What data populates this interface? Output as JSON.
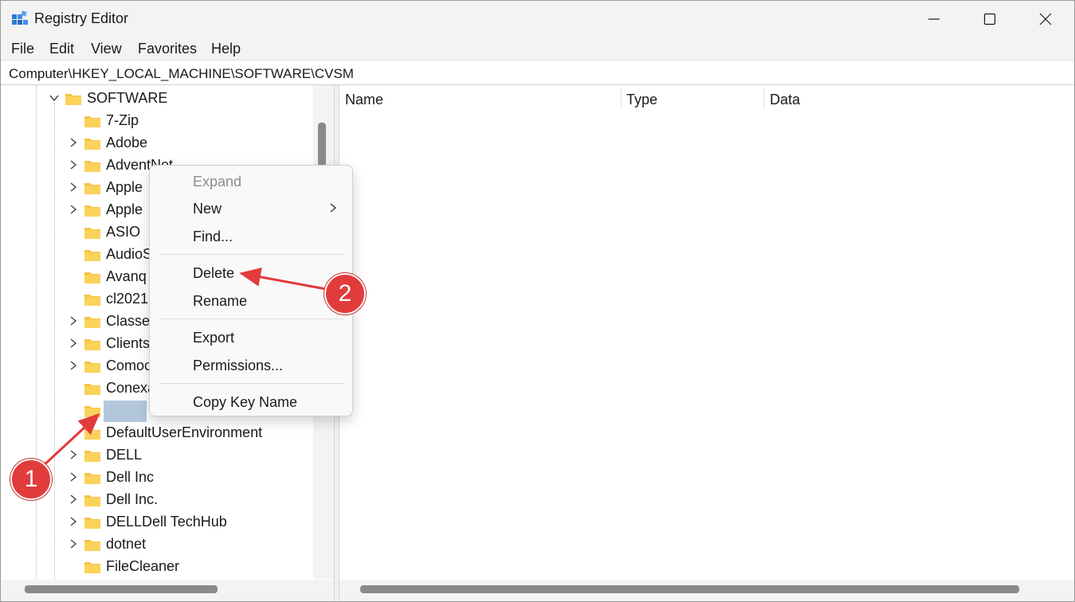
{
  "window": {
    "title": "Registry Editor"
  },
  "menu": {
    "items": [
      "File",
      "Edit",
      "View",
      "Favorites",
      "Help"
    ]
  },
  "address": {
    "path": "Computer\\HKEY_LOCAL_MACHINE\\SOFTWARE\\CVSM"
  },
  "tree": {
    "parent_label": "SOFTWARE",
    "nodes": [
      {
        "label": "7-Zip",
        "has_children": false
      },
      {
        "label": "Adobe",
        "has_children": true
      },
      {
        "label": "AdventNet",
        "has_children": true
      },
      {
        "label": "Apple",
        "has_children": true
      },
      {
        "label": "Apple",
        "has_children": true
      },
      {
        "label": "ASIO",
        "has_children": false
      },
      {
        "label": "AudioS",
        "has_children": false
      },
      {
        "label": "Avanq",
        "has_children": false
      },
      {
        "label": "cl2021",
        "has_children": false
      },
      {
        "label": "Classes",
        "has_children": true
      },
      {
        "label": "Clients",
        "has_children": true
      },
      {
        "label": "Comoc",
        "has_children": true
      },
      {
        "label": "Conexa",
        "has_children": false
      },
      {
        "label": "",
        "has_children": false,
        "selected": true
      },
      {
        "label": "DefaultUserEnvironment",
        "has_children": false
      },
      {
        "label": "DELL",
        "has_children": true
      },
      {
        "label": "Dell Inc",
        "has_children": true
      },
      {
        "label": "Dell Inc.",
        "has_children": true
      },
      {
        "label": "DELLDell TechHub",
        "has_children": true
      },
      {
        "label": "dotnet",
        "has_children": true
      },
      {
        "label": "FileCleaner",
        "has_children": false
      }
    ]
  },
  "list": {
    "columns": [
      "Name",
      "Type",
      "Data"
    ]
  },
  "context_menu": {
    "expand": "Expand",
    "new": "New",
    "find": "Find...",
    "delete": "Delete",
    "rename": "Rename",
    "export": "Export",
    "permissions": "Permissions...",
    "copy_key_name": "Copy Key Name"
  },
  "annotations": {
    "step1": "1",
    "step2": "2",
    "color": "#e23b3b"
  },
  "icons": {
    "app": "registry-editor-icon",
    "folder": "folder-icon",
    "expand": "chevron-right-icon",
    "collapse": "chevron-down-icon",
    "minimize": "minimize-icon",
    "maximize": "maximize-icon",
    "close": "close-icon",
    "submenu": "submenu-arrow-icon"
  },
  "colors": {
    "folder": "#f6c244",
    "selection": "#b3c7dc"
  }
}
